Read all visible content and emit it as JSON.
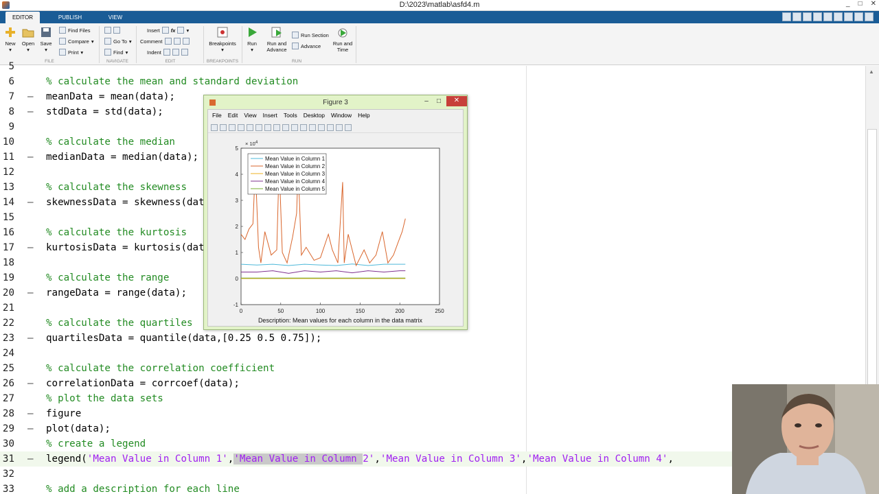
{
  "window": {
    "title": "D:\\2023\\matlab\\asfd4.m",
    "controls": [
      "_",
      "□",
      "✕"
    ]
  },
  "ribbon": {
    "tabs": [
      "EDITOR",
      "PUBLISH",
      "VIEW"
    ],
    "file": {
      "new": "New",
      "open": "Open",
      "save": "Save",
      "find_files": "Find Files",
      "compare": "Compare",
      "print": "Print",
      "group": "FILE"
    },
    "navigate": {
      "go_to": "Go To",
      "find": "Find",
      "group": "NAVIGATE"
    },
    "edit": {
      "insert": "Insert",
      "comment": "Comment",
      "indent": "Indent",
      "fx": "fx",
      "group": "EDIT"
    },
    "breakpoints": {
      "label": "Breakpoints",
      "group": "BREAKPOINTS"
    },
    "run": {
      "run": "Run",
      "run_advance_1": "Run and",
      "run_advance_2": "Advance",
      "run_section": "Run Section",
      "advance": "Advance",
      "run_time_1": "Run and",
      "run_time_2": "Time",
      "group": "RUN"
    }
  },
  "editor": {
    "lines": [
      {
        "n": "5",
        "dash": false,
        "tokens": []
      },
      {
        "n": "6",
        "dash": false,
        "tokens": [
          {
            "t": "% calculate the mean and standard deviation",
            "k": "comment"
          }
        ]
      },
      {
        "n": "7",
        "dash": true,
        "tokens": [
          {
            "t": "meanData = mean(data);",
            "k": "plain"
          }
        ]
      },
      {
        "n": "8",
        "dash": true,
        "tokens": [
          {
            "t": "stdData = std(data);",
            "k": "plain"
          }
        ]
      },
      {
        "n": "9",
        "dash": false,
        "tokens": []
      },
      {
        "n": "10",
        "dash": false,
        "tokens": [
          {
            "t": "% calculate the median",
            "k": "comment"
          }
        ]
      },
      {
        "n": "11",
        "dash": true,
        "tokens": [
          {
            "t": "medianData = median(data);",
            "k": "plain"
          }
        ]
      },
      {
        "n": "12",
        "dash": false,
        "tokens": []
      },
      {
        "n": "13",
        "dash": false,
        "tokens": [
          {
            "t": "% calculate the skewness",
            "k": "comment"
          }
        ]
      },
      {
        "n": "14",
        "dash": true,
        "tokens": [
          {
            "t": "skewnessData = skewness(data);",
            "k": "plain"
          }
        ]
      },
      {
        "n": "15",
        "dash": false,
        "tokens": []
      },
      {
        "n": "16",
        "dash": false,
        "tokens": [
          {
            "t": "% calculate the kurtosis",
            "k": "comment"
          }
        ]
      },
      {
        "n": "17",
        "dash": true,
        "tokens": [
          {
            "t": "kurtosisData = kurtosis(data);",
            "k": "plain"
          }
        ]
      },
      {
        "n": "18",
        "dash": false,
        "tokens": []
      },
      {
        "n": "19",
        "dash": false,
        "tokens": [
          {
            "t": "% calculate the range",
            "k": "comment"
          }
        ]
      },
      {
        "n": "20",
        "dash": true,
        "tokens": [
          {
            "t": "rangeData = range(data);",
            "k": "plain"
          }
        ]
      },
      {
        "n": "21",
        "dash": false,
        "tokens": []
      },
      {
        "n": "22",
        "dash": false,
        "tokens": [
          {
            "t": "% calculate the quartiles",
            "k": "comment"
          }
        ]
      },
      {
        "n": "23",
        "dash": true,
        "tokens": [
          {
            "t": "quartilesData = quantile(data,[0.25 0.5 0.75]);",
            "k": "plain"
          }
        ]
      },
      {
        "n": "24",
        "dash": false,
        "tokens": []
      },
      {
        "n": "25",
        "dash": false,
        "tokens": [
          {
            "t": "% calculate the correlation coefficient",
            "k": "comment"
          }
        ]
      },
      {
        "n": "26",
        "dash": true,
        "tokens": [
          {
            "t": "correlationData = corrcoef(data);",
            "k": "plain"
          }
        ]
      },
      {
        "n": "27",
        "dash": false,
        "tokens": [
          {
            "t": "% plot the data sets",
            "k": "comment"
          }
        ]
      },
      {
        "n": "28",
        "dash": true,
        "tokens": [
          {
            "t": "figure",
            "k": "plain"
          }
        ]
      },
      {
        "n": "29",
        "dash": true,
        "tokens": [
          {
            "t": "plot(data);",
            "k": "plain"
          }
        ]
      },
      {
        "n": "30",
        "dash": false,
        "tokens": [
          {
            "t": "% create a legend",
            "k": "comment"
          }
        ]
      },
      {
        "n": "31",
        "dash": true,
        "current": true,
        "tokens": [
          {
            "t": "legend(",
            "k": "plain"
          },
          {
            "t": "'Mean Value in Column 1'",
            "k": "str"
          },
          {
            "t": ",",
            "k": "plain"
          },
          {
            "t": "'Mean Value in Column ",
            "k": "hl"
          },
          {
            "t": "2'",
            "k": "str"
          },
          {
            "t": ",",
            "k": "plain"
          },
          {
            "t": "'Mean Value in Column 3'",
            "k": "str"
          },
          {
            "t": ",",
            "k": "plain"
          },
          {
            "t": "'Mean Value in Column 4'",
            "k": "str"
          },
          {
            "t": ",",
            "k": "plain"
          }
        ]
      },
      {
        "n": "32",
        "dash": false,
        "tokens": []
      },
      {
        "n": "33",
        "dash": false,
        "tokens": [
          {
            "t": "% add a description for each line",
            "k": "comment"
          }
        ]
      }
    ]
  },
  "figure": {
    "title": "Figure 3",
    "menu": [
      "File",
      "Edit",
      "View",
      "Insert",
      "Tools",
      "Desktop",
      "Window",
      "Help"
    ],
    "toolbar_icons": [
      "new-figure-icon",
      "open-file-icon",
      "save-icon",
      "print-icon",
      "pointer-icon",
      "zoom-in-icon",
      "zoom-out-icon",
      "pan-icon",
      "rotate-icon",
      "data-cursor-icon",
      "brush-icon",
      "link-icon",
      "colorbar-icon",
      "legend-icon",
      "hide-tools-icon",
      "show-tools-icon"
    ]
  },
  "chart_data": {
    "type": "line",
    "title": "",
    "xlabel": "Description: Mean values for each column in the data matrix",
    "ylabel": "",
    "xlim": [
      0,
      250
    ],
    "ylim": [
      -1,
      5
    ],
    "y_multiplier": "× 10^4",
    "y_multiplier_base": "× 10",
    "y_multiplier_exp": "4",
    "xticks": [
      0,
      50,
      100,
      150,
      200,
      250
    ],
    "yticks": [
      -1,
      0,
      1,
      2,
      3,
      4,
      5
    ],
    "grid": false,
    "legend_position": "top-left",
    "series": [
      {
        "name": "Mean Value in Column 1",
        "color": "#4db8d9",
        "x": [
          0,
          20,
          40,
          60,
          80,
          100,
          120,
          140,
          160,
          180,
          200,
          207
        ],
        "y": [
          0.55,
          0.52,
          0.55,
          0.5,
          0.55,
          0.52,
          0.5,
          0.56,
          0.5,
          0.55,
          0.55,
          0.55
        ]
      },
      {
        "name": "Mean Value in Column 2",
        "color": "#d9652b",
        "x": [
          0,
          5,
          10,
          15,
          18,
          22,
          25,
          30,
          38,
          45,
          48,
          52,
          58,
          65,
          70,
          72,
          76,
          82,
          92,
          100,
          110,
          115,
          122,
          128,
          130,
          135,
          145,
          155,
          162,
          170,
          178,
          185,
          192,
          198,
          203,
          207
        ],
        "y": [
          1.7,
          1.5,
          1.9,
          2.1,
          4.3,
          1.2,
          0.6,
          1.8,
          0.9,
          1.1,
          4.4,
          1.0,
          0.6,
          1.6,
          2.5,
          4.3,
          0.9,
          1.2,
          0.7,
          0.8,
          1.7,
          1.1,
          0.6,
          3.7,
          0.6,
          1.7,
          0.5,
          1.1,
          0.6,
          0.9,
          1.8,
          0.6,
          0.9,
          1.4,
          1.8,
          2.3
        ]
      },
      {
        "name": "Mean Value in Column 3",
        "color": "#edb120",
        "x": [
          0,
          207
        ],
        "y": [
          0.0,
          0.0
        ]
      },
      {
        "name": "Mean Value in Column 4",
        "color": "#7e2f8e",
        "x": [
          0,
          20,
          40,
          60,
          80,
          100,
          120,
          140,
          160,
          180,
          200,
          207
        ],
        "y": [
          0.25,
          0.25,
          0.3,
          0.2,
          0.3,
          0.25,
          0.3,
          0.22,
          0.3,
          0.25,
          0.3,
          0.3
        ]
      },
      {
        "name": "Mean Value in Column 5",
        "color": "#77ac30",
        "x": [
          0,
          207
        ],
        "y": [
          0.02,
          0.02
        ]
      }
    ]
  }
}
